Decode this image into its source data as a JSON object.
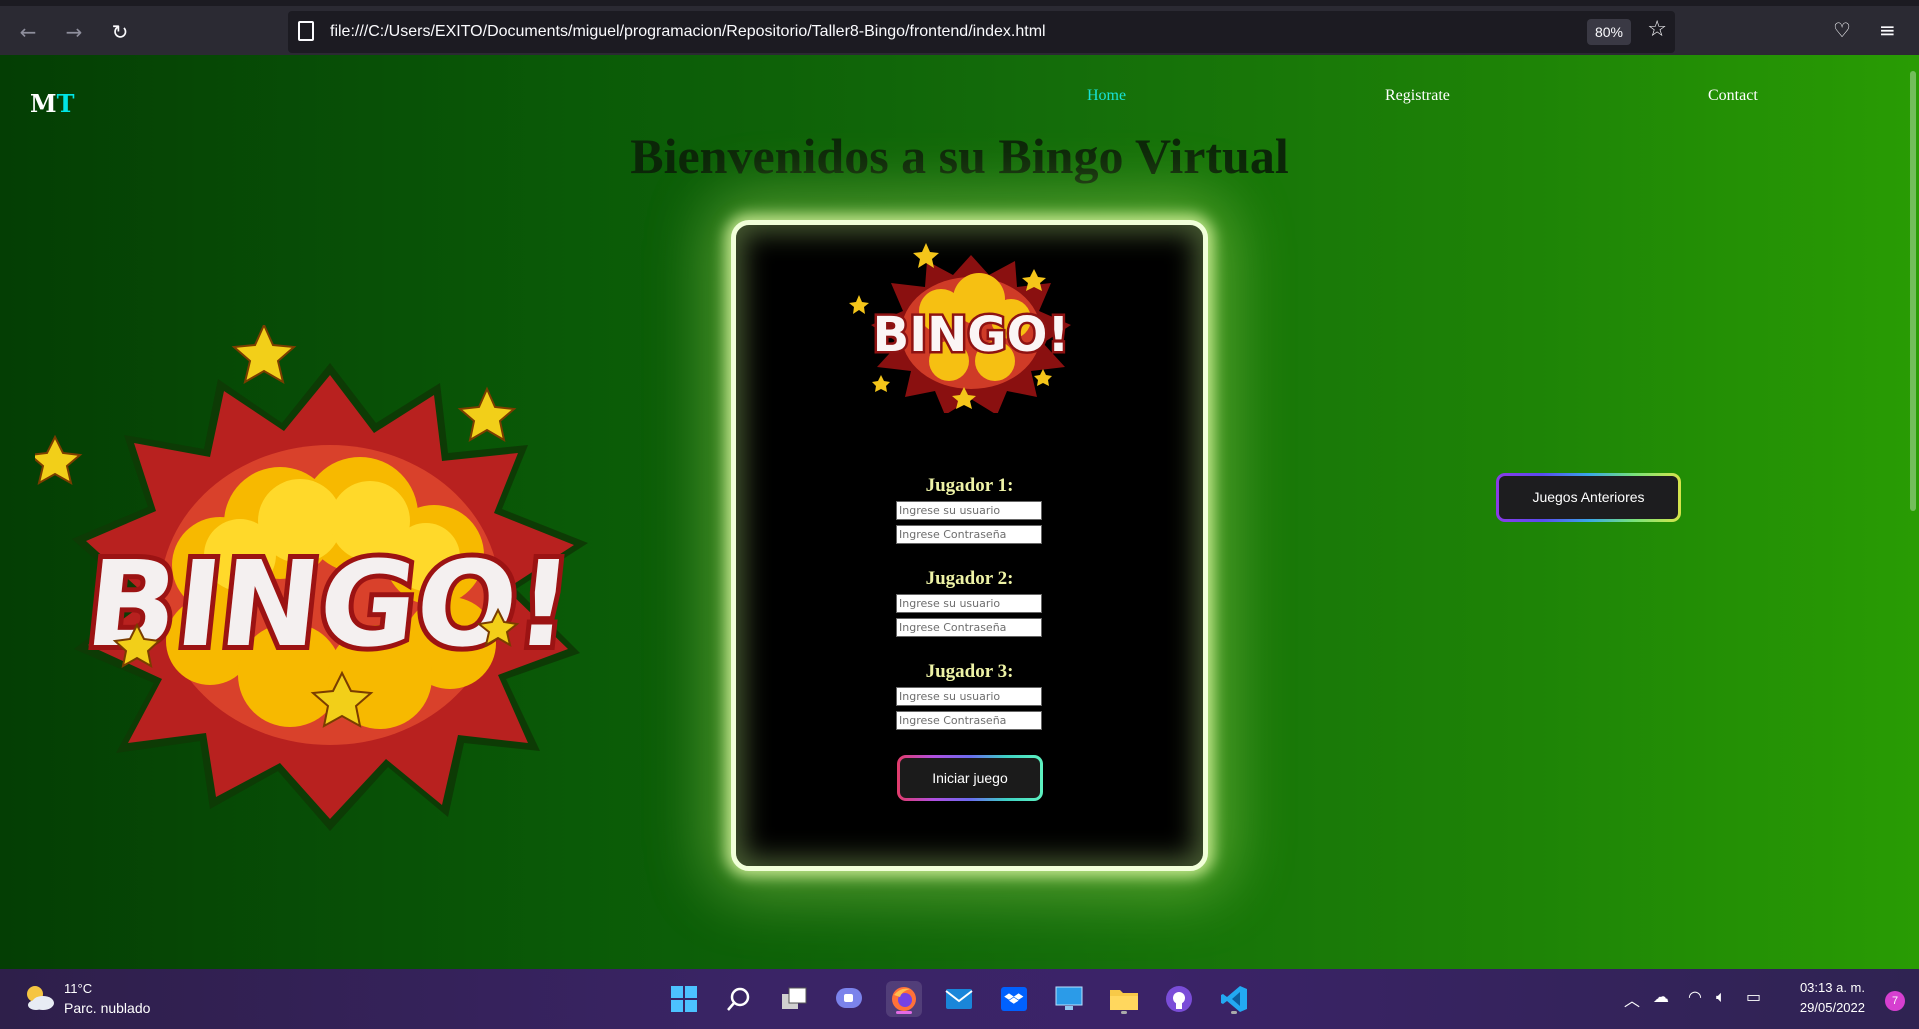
{
  "browser": {
    "url": "file:///C:/Users/EXITO/Documents/miguel/programacion/Repositorio/Taller8-Bingo/frontend/index.html",
    "zoom": "80%"
  },
  "site": {
    "logo_m": "M",
    "logo_t": "T",
    "nav": {
      "home": "Home",
      "register": "Registrate",
      "contact": "Contact"
    },
    "title": "Bienvenidos a su Bingo Virtual",
    "bingo_logo_text": "BINGO!"
  },
  "form": {
    "players": [
      {
        "label": "Jugador 1:",
        "user_placeholder": "Ingrese su usuario",
        "pass_placeholder": "Ingrese Contraseña"
      },
      {
        "label": "Jugador 2:",
        "user_placeholder": "Ingrese su usuario",
        "pass_placeholder": "Ingrese Contraseña"
      },
      {
        "label": "Jugador 3:",
        "user_placeholder": "Ingrese su usuario",
        "pass_placeholder": "Ingrese Contraseña"
      }
    ],
    "start_label": "Iniciar juego"
  },
  "previous_games_label": "Juegos Anteriores",
  "taskbar": {
    "temperature": "11°C",
    "weather": "Parc. nublado",
    "time": "03:13 a. m.",
    "date": "29/05/2022",
    "notifications": "7"
  }
}
